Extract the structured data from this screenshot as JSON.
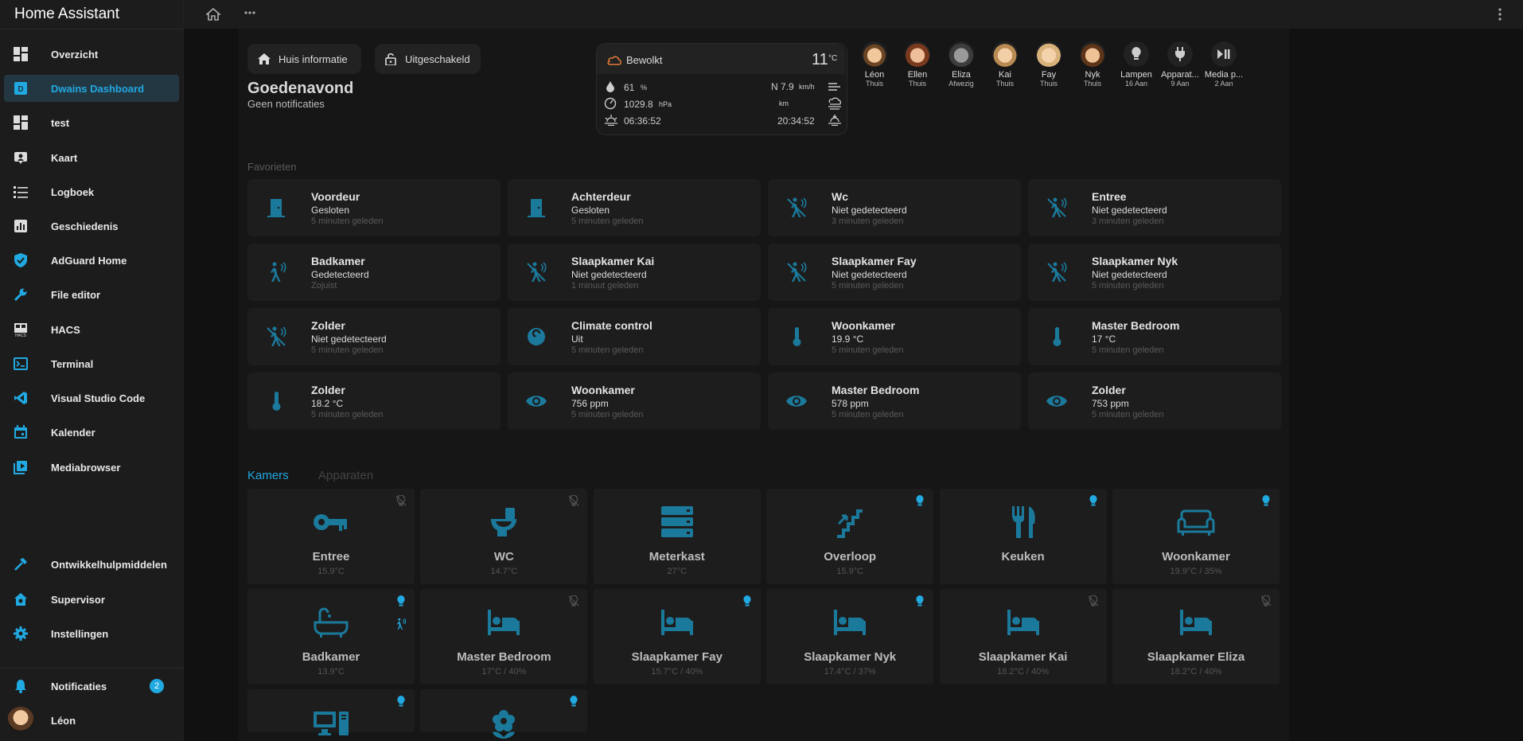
{
  "app": {
    "title": "Home Assistant"
  },
  "sidebar": {
    "items": [
      {
        "label": "Overzicht",
        "icon": "dashboard-icon"
      },
      {
        "label": "Dwains Dashboard",
        "icon": "dwains-icon"
      },
      {
        "label": "test",
        "icon": "dashboard-icon"
      },
      {
        "label": "Kaart",
        "icon": "map-icon"
      },
      {
        "label": "Logboek",
        "icon": "logbook-icon"
      },
      {
        "label": "Geschiedenis",
        "icon": "history-icon"
      },
      {
        "label": "AdGuard Home",
        "icon": "shield-icon"
      },
      {
        "label": "File editor",
        "icon": "wrench-icon"
      },
      {
        "label": "HACS",
        "icon": "hacs-icon"
      },
      {
        "label": "Terminal",
        "icon": "terminal-icon"
      },
      {
        "label": "Visual Studio Code",
        "icon": "vscode-icon"
      },
      {
        "label": "Kalender",
        "icon": "calendar-icon"
      },
      {
        "label": "Mediabrowser",
        "icon": "media-icon"
      }
    ],
    "bottom": [
      {
        "label": "Ontwikkelhulpmiddelen",
        "icon": "hammer-icon"
      },
      {
        "label": "Supervisor",
        "icon": "supervisor-icon"
      },
      {
        "label": "Instellingen",
        "icon": "gear-icon"
      }
    ],
    "notifications": {
      "label": "Notificaties",
      "count": "2"
    },
    "user": {
      "label": "Léon"
    }
  },
  "header": {
    "huis_info": "Huis informatie",
    "uitgeschakeld": "Uitgeschakeld",
    "greeting": "Goedenavond",
    "notifications": "Geen notificaties"
  },
  "weather": {
    "condition": "Bewolkt",
    "temp": "11",
    "temp_unit": "°C",
    "humidity": "61",
    "humidity_unit": "%",
    "wind": "N 7.9",
    "wind_unit": "km/h",
    "pressure": "1029.8",
    "pressure_unit": "hPa",
    "visibility_unit": "km",
    "sunrise": "06:36:52",
    "sunset": "20:34:52"
  },
  "people": [
    {
      "name": "Léon",
      "state": "Thuis"
    },
    {
      "name": "Ellen",
      "state": "Thuis"
    },
    {
      "name": "Eliza",
      "state": "Afwezig"
    },
    {
      "name": "Kai",
      "state": "Thuis"
    },
    {
      "name": "Fay",
      "state": "Thuis"
    },
    {
      "name": "Nyk",
      "state": "Thuis"
    },
    {
      "name": "Lampen",
      "state": "16 Aan"
    },
    {
      "name": "Apparat...",
      "state": "9 Aan"
    },
    {
      "name": "Media p...",
      "state": "2 Aan"
    }
  ],
  "favorites": {
    "title": "Favorieten",
    "items": [
      {
        "name": "Voordeur",
        "state": "Gesloten",
        "time": "5 minuten geleden",
        "icon": "door-icon"
      },
      {
        "name": "Achterdeur",
        "state": "Gesloten",
        "time": "5 minuten geleden",
        "icon": "door-icon"
      },
      {
        "name": "Wc",
        "state": "Niet gedetecteerd",
        "time": "3 minuten geleden",
        "icon": "motion-off-icon"
      },
      {
        "name": "Entree",
        "state": "Niet gedetecteerd",
        "time": "3 minuten geleden",
        "icon": "motion-off-icon"
      },
      {
        "name": "Badkamer",
        "state": "Gedetecteerd",
        "time": "Zojuist",
        "icon": "motion-icon"
      },
      {
        "name": "Slaapkamer Kai",
        "state": "Niet gedetecteerd",
        "time": "1 minuut geleden",
        "icon": "motion-off-icon"
      },
      {
        "name": "Slaapkamer Fay",
        "state": "Niet gedetecteerd",
        "time": "5 minuten geleden",
        "icon": "motion-off-icon"
      },
      {
        "name": "Slaapkamer Nyk",
        "state": "Niet gedetecteerd",
        "time": "5 minuten geleden",
        "icon": "motion-off-icon"
      },
      {
        "name": "Zolder",
        "state": "Niet gedetecteerd",
        "time": "5 minuten geleden",
        "icon": "motion-off-icon"
      },
      {
        "name": "Climate control",
        "state": "Uit",
        "time": "5 minuten geleden",
        "icon": "thermostat-icon"
      },
      {
        "name": "Woonkamer",
        "state": "19.9 °C",
        "time": "5 minuten geleden",
        "icon": "thermometer-icon"
      },
      {
        "name": "Master Bedroom",
        "state": "17 °C",
        "time": "5 minuten geleden",
        "icon": "thermometer-icon"
      },
      {
        "name": "Zolder",
        "state": "18.2 °C",
        "time": "5 minuten geleden",
        "icon": "thermometer-icon"
      },
      {
        "name": "Woonkamer",
        "state": "756 ppm",
        "time": "5 minuten geleden",
        "icon": "eye-icon"
      },
      {
        "name": "Master Bedroom",
        "state": "578 ppm",
        "time": "5 minuten geleden",
        "icon": "eye-icon"
      },
      {
        "name": "Zolder",
        "state": "753 ppm",
        "time": "5 minuten geleden",
        "icon": "eye-icon"
      }
    ]
  },
  "tabs": {
    "kamers": "Kamers",
    "apparaten": "Apparaten"
  },
  "rooms": [
    {
      "name": "Entree",
      "value": "15.9°C",
      "icon": "key-icon",
      "bulb": "off"
    },
    {
      "name": "WC",
      "value": "14.7°C",
      "icon": "toilet-icon",
      "bulb": "off"
    },
    {
      "name": "Meterkast",
      "value": "27°C",
      "icon": "server-icon",
      "bulb": "none"
    },
    {
      "name": "Overloop",
      "value": "15.9°C",
      "icon": "stairs-icon",
      "bulb": "on"
    },
    {
      "name": "Keuken",
      "value": "",
      "icon": "cutlery-icon",
      "bulb": "on"
    },
    {
      "name": "Woonkamer",
      "value": "19.9°C / 35%",
      "icon": "sofa-icon",
      "bulb": "on"
    },
    {
      "name": "Badkamer",
      "value": "13.9°C",
      "icon": "bathtub-icon",
      "bulb": "on"
    },
    {
      "name": "Master Bedroom",
      "value": "17°C / 40%",
      "icon": "bed-icon",
      "bulb": "off"
    },
    {
      "name": "Slaapkamer Fay",
      "value": "15.7°C / 40%",
      "icon": "bed-icon",
      "bulb": "on"
    },
    {
      "name": "Slaapkamer Nyk",
      "value": "17.4°C / 37%",
      "icon": "bed-icon",
      "bulb": "on"
    },
    {
      "name": "Slaapkamer Kai",
      "value": "18.2°C / 40%",
      "icon": "bed-icon",
      "bulb": "off"
    },
    {
      "name": "Slaapkamer Eliza",
      "value": "18.2°C / 40%",
      "icon": "bed-icon",
      "bulb": "off"
    },
    {
      "name": "",
      "value": "",
      "icon": "desktop-icon",
      "bulb": "on"
    },
    {
      "name": "",
      "value": "",
      "icon": "flower-icon",
      "bulb": "on"
    }
  ],
  "colors": {
    "accent": "#21a9e1",
    "icon": "#1b7a9c",
    "card": "#1d1d1d"
  }
}
